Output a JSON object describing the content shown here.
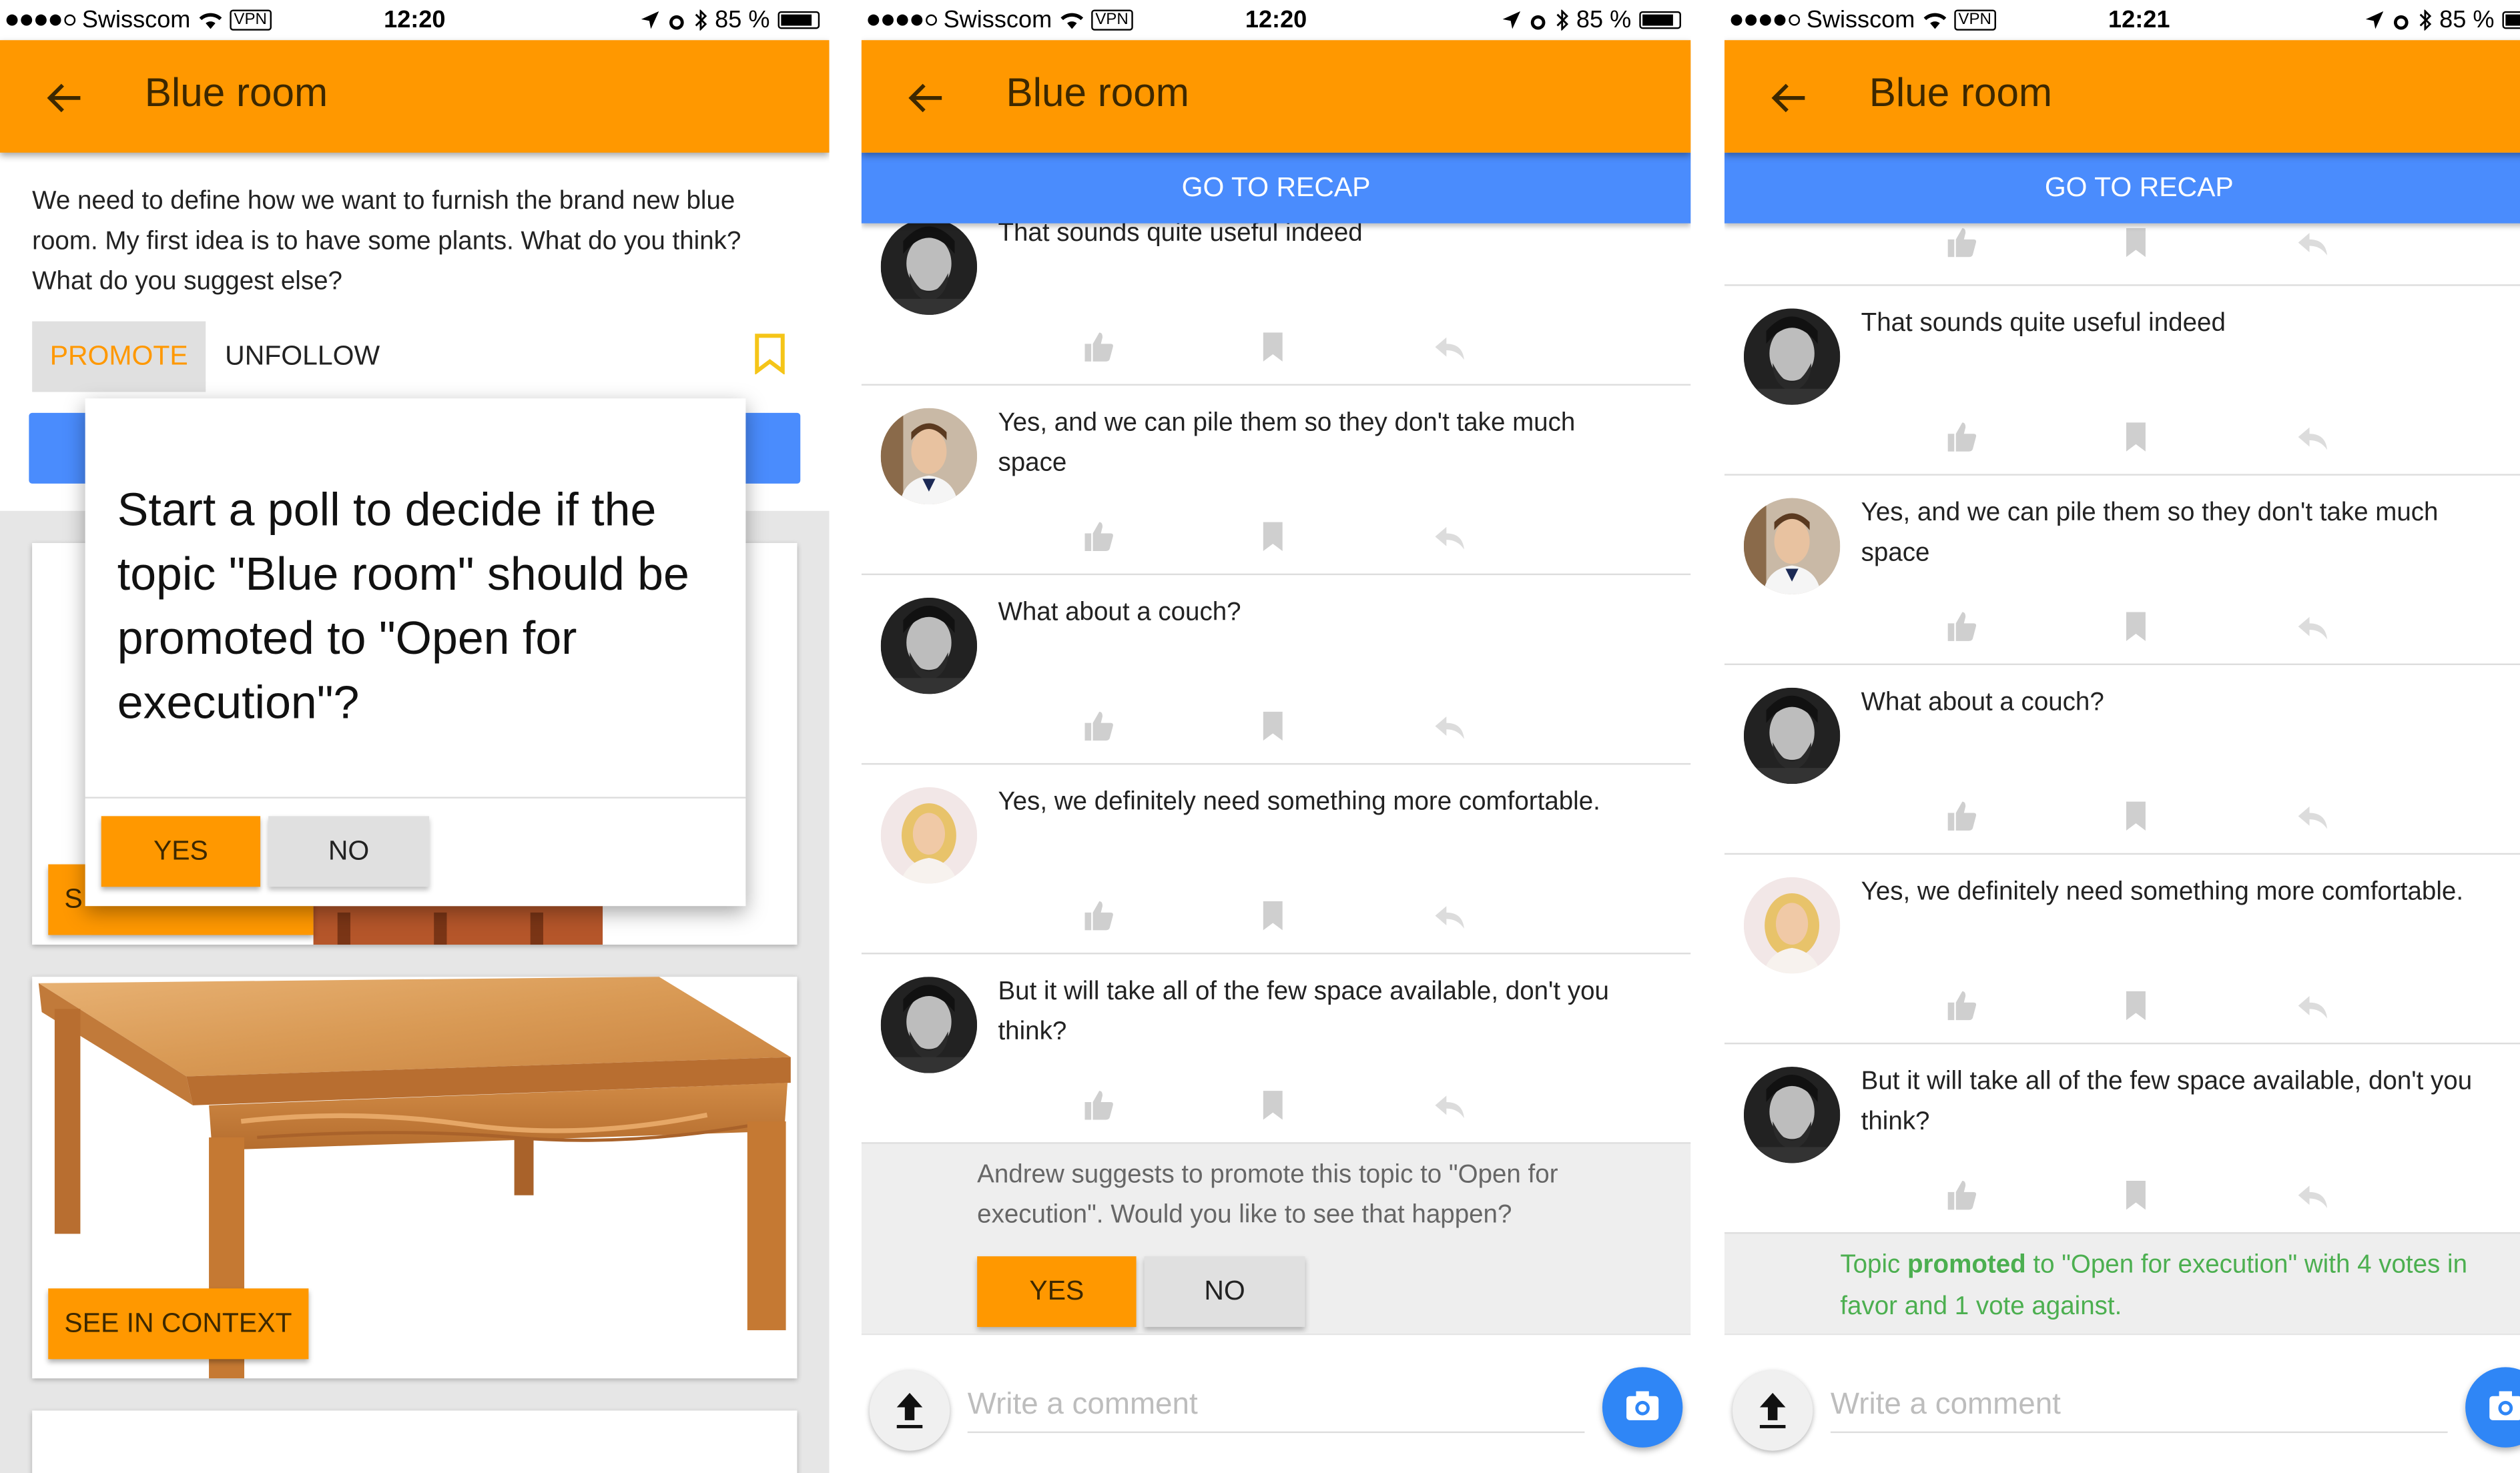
{
  "status_bars": [
    {
      "carrier": "Swisscom",
      "vpn": "VPN",
      "time": "12:20",
      "battery": "85 %"
    },
    {
      "carrier": "Swisscom",
      "vpn": "VPN",
      "time": "12:20",
      "battery": "85 %"
    },
    {
      "carrier": "Swisscom",
      "vpn": "VPN",
      "time": "12:21",
      "battery": "85 %"
    }
  ],
  "topic_title": "Blue room",
  "recap_label": "GO TO RECAP",
  "panel1": {
    "description": "We need to define how we want to furnish the brand new blue room. My first idea is to have some plants. What do you think? What do you suggest else?",
    "promote_label": "PROMOTE",
    "unfollow_label": "UNFOLLOW",
    "see_in_context_label": "SEE IN CONTEXT",
    "partial_button_letter": "S",
    "dialog": {
      "question": "Start a poll to decide if the topic \"Blue room\" should be promoted to \"Open for execution\"?",
      "yes_label": "YES",
      "no_label": "NO"
    }
  },
  "comments": [
    {
      "author_avatar": "bearded-man",
      "text": "That sounds quite useful indeed"
    },
    {
      "author_avatar": "young-man",
      "text": "Yes, and we can pile them so they don't take much\nspace"
    },
    {
      "author_avatar": "bearded-man",
      "text": "What about a couch?"
    },
    {
      "author_avatar": "blonde-woman",
      "text": "Yes, we definitely need something more comfortable."
    },
    {
      "author_avatar": "bearded-man",
      "text": "But it will take all of the few space available, don't you\nthink?"
    }
  ],
  "panel2": {
    "suggestion": "Andrew suggests to promote this topic to \"Open for execution\". Would you like to see that happen?",
    "yes_label": "YES",
    "no_label": "NO"
  },
  "panel3": {
    "result_before": "Topic ",
    "result_bold": "promoted",
    "result_after": " to \"Open for execution\" with 4 votes in favor and 1 vote against.",
    "result_line2": "favor and 1 vote against."
  },
  "composer_placeholder": "Write a comment",
  "icons": {
    "back": "arrow-back-icon",
    "like": "thumb-up-icon",
    "bookmark": "bookmark-icon",
    "reply": "reply-icon",
    "upload": "upload-icon",
    "camera": "camera-icon"
  },
  "colors": {
    "accent": "#ff9800",
    "recap_blue": "#4a8cfd",
    "camera_blue": "#2f86f6",
    "success_green": "#4caf50"
  }
}
